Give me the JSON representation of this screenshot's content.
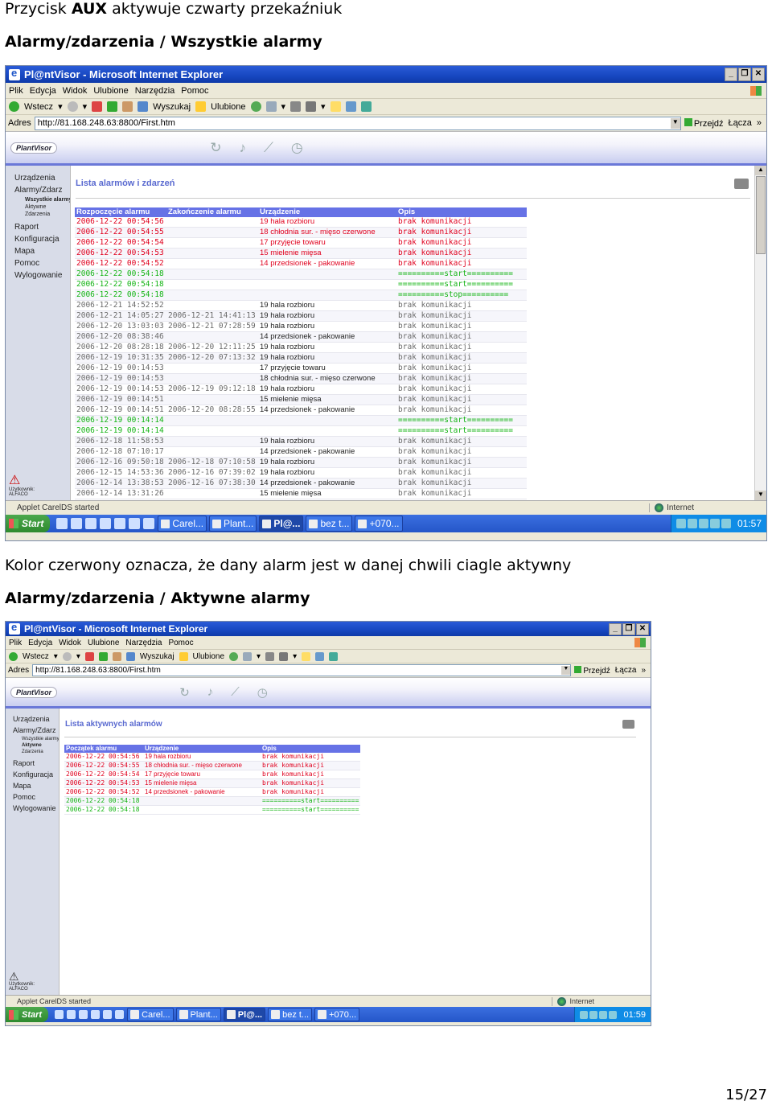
{
  "doc": {
    "intro_prefix": "Przycisk ",
    "intro_bold": "AUX",
    "intro_suffix": " aktywuje czwarty przekaźniuk",
    "heading1": "Alarmy/zdarzenia / Wszystkie alarmy",
    "note": "Kolor czerwony oznacza, że dany alarm jest w danej chwili ciagle aktywny",
    "heading2": "Alarmy/zdarzenia / Aktywne alarmy",
    "page_number": "15/27"
  },
  "browser": {
    "title": "Pl@ntVisor - Microsoft Internet Explorer",
    "menu": [
      "Plik",
      "Edycja",
      "Widok",
      "Ulubione",
      "Narzędzia",
      "Pomoc"
    ],
    "back": "Wstecz",
    "search": "Wyszukaj",
    "favorites": "Ulubione",
    "address_label": "Adres",
    "url": "http://81.168.248.63:8800/First.htm",
    "go": "Przejdź",
    "links": "Łącza",
    "status_text": "Applet CarelDS started",
    "zone": "Internet"
  },
  "plantvisor": {
    "logo": "PlantVisor",
    "user_label": "Użytkownik:",
    "user_name": "ALFACO"
  },
  "sidebar1": {
    "items_top": [
      "Urządzenia",
      "Alarmy/Zdarz"
    ],
    "subitems": [
      "Wszystkie alarmy",
      "Aktywne",
      "Zdarzenia"
    ],
    "items_bottom": [
      "Raport",
      "Konfiguracja",
      "Mapa",
      "Pomoc",
      "Wylogowanie"
    ]
  },
  "sidebar2": {
    "items_top": [
      "Urządzenia",
      "Alarmy/Zdarz"
    ],
    "subitems": [
      "Wszystkie alarmy",
      "Aktywne",
      "Zdarzenia"
    ],
    "items_bottom": [
      "Raport",
      "Konfiguracja",
      "Mapa",
      "Pomoc",
      "Wylogowanie"
    ]
  },
  "screen1": {
    "page_title": "Lista alarmów i zdarzeń",
    "columns": [
      "Rozpoczęcie alarmu",
      "Zakończenie alarmu",
      "Urządzenie",
      "Opis"
    ],
    "rows": [
      {
        "s": "red",
        "start": "2006-12-22 00:54:56",
        "end": "",
        "dev": "19 hala rozbioru",
        "desc": "brak komunikacji"
      },
      {
        "s": "red",
        "start": "2006-12-22 00:54:55",
        "end": "",
        "dev": "18 chłodnia sur. - mięso czerwone",
        "desc": "brak komunikacji"
      },
      {
        "s": "red",
        "start": "2006-12-22 00:54:54",
        "end": "",
        "dev": "17 przyjęcie towaru",
        "desc": "brak komunikacji"
      },
      {
        "s": "red",
        "start": "2006-12-22 00:54:53",
        "end": "",
        "dev": "15 mielenie mięsa",
        "desc": "brak komunikacji"
      },
      {
        "s": "red",
        "start": "2006-12-22 00:54:52",
        "end": "",
        "dev": "14 przedsionek - pakowanie",
        "desc": "brak komunikacji"
      },
      {
        "s": "green",
        "start": "2006-12-22 00:54:18",
        "end": "",
        "dev": "",
        "desc": "==========start=========="
      },
      {
        "s": "green",
        "start": "2006-12-22 00:54:18",
        "end": "",
        "dev": "",
        "desc": "==========start=========="
      },
      {
        "s": "green",
        "start": "2006-12-22 00:54:18",
        "end": "",
        "dev": "",
        "desc": "==========stop=========="
      },
      {
        "s": "gray",
        "start": "2006-12-21 14:52:52",
        "end": "",
        "dev": "19 hala rozbioru",
        "desc": "brak komunikacji"
      },
      {
        "s": "gray",
        "start": "2006-12-21 14:05:27",
        "end": "2006-12-21 14:41:13",
        "dev": "19 hala rozbioru",
        "desc": "brak komunikacji"
      },
      {
        "s": "gray",
        "start": "2006-12-20 13:03:03",
        "end": "2006-12-21 07:28:59",
        "dev": "19 hala rozbioru",
        "desc": "brak komunikacji"
      },
      {
        "s": "gray",
        "start": "2006-12-20 08:38:46",
        "end": "",
        "dev": "14 przedsionek - pakowanie",
        "desc": "brak komunikacji"
      },
      {
        "s": "gray",
        "start": "2006-12-20 08:28:18",
        "end": "2006-12-20 12:11:25",
        "dev": "19 hala rozbioru",
        "desc": "brak komunikacji"
      },
      {
        "s": "gray",
        "start": "2006-12-19 10:31:35",
        "end": "2006-12-20 07:13:32",
        "dev": "19 hala rozbioru",
        "desc": "brak komunikacji"
      },
      {
        "s": "gray",
        "start": "2006-12-19 00:14:53",
        "end": "",
        "dev": "17 przyjęcie towaru",
        "desc": "brak komunikacji"
      },
      {
        "s": "gray",
        "start": "2006-12-19 00:14:53",
        "end": "",
        "dev": "18 chłodnia sur. - mięso czerwone",
        "desc": "brak komunikacji"
      },
      {
        "s": "gray",
        "start": "2006-12-19 00:14:53",
        "end": "2006-12-19 09:12:18",
        "dev": "19 hala rozbioru",
        "desc": "brak komunikacji"
      },
      {
        "s": "gray",
        "start": "2006-12-19 00:14:51",
        "end": "",
        "dev": "15 mielenie mięsa",
        "desc": "brak komunikacji"
      },
      {
        "s": "gray",
        "start": "2006-12-19 00:14:51",
        "end": "2006-12-20 08:28:55",
        "dev": "14 przedsionek - pakowanie",
        "desc": "brak komunikacji"
      },
      {
        "s": "green",
        "start": "2006-12-19 00:14:14",
        "end": "",
        "dev": "",
        "desc": "==========start=========="
      },
      {
        "s": "green",
        "start": "2006-12-19 00:14:14",
        "end": "",
        "dev": "",
        "desc": "==========start=========="
      },
      {
        "s": "gray",
        "start": "2006-12-18 11:58:53",
        "end": "",
        "dev": "19 hala rozbioru",
        "desc": "brak komunikacji"
      },
      {
        "s": "gray",
        "start": "2006-12-18 07:10:17",
        "end": "",
        "dev": "14 przedsionek - pakowanie",
        "desc": "brak komunikacji"
      },
      {
        "s": "gray",
        "start": "2006-12-16 09:50:18",
        "end": "2006-12-18 07:10:58",
        "dev": "19 hala rozbioru",
        "desc": "brak komunikacji"
      },
      {
        "s": "gray",
        "start": "2006-12-15 14:53:36",
        "end": "2006-12-16 07:39:02",
        "dev": "19 hala rozbioru",
        "desc": "brak komunikacji"
      },
      {
        "s": "gray",
        "start": "2006-12-14 13:38:53",
        "end": "2006-12-16 07:38:30",
        "dev": "14 przedsionek - pakowanie",
        "desc": "brak komunikacji"
      },
      {
        "s": "gray",
        "start": "2006-12-14 13:31:26",
        "end": "",
        "dev": "15 mielenie mięsa",
        "desc": "brak komunikacji"
      }
    ]
  },
  "screen2": {
    "page_title": "Lista aktywnych alarmów",
    "columns": [
      "Początek alarmu",
      "Urządzenie",
      "Opis"
    ],
    "rows": [
      {
        "s": "red",
        "start": "2006-12-22 00:54:56",
        "dev": "19 hala rozbioru",
        "desc": "brak komunikacji"
      },
      {
        "s": "red",
        "start": "2006-12-22 00:54:55",
        "dev": "18 chłodnia sur. - mięso czerwone",
        "desc": "brak komunikacji"
      },
      {
        "s": "red",
        "start": "2006-12-22 00:54:54",
        "dev": "17 przyjęcie towaru",
        "desc": "brak komunikacji"
      },
      {
        "s": "red",
        "start": "2006-12-22 00:54:53",
        "dev": "15 mielenie mięsa",
        "desc": "brak komunikacji"
      },
      {
        "s": "red",
        "start": "2006-12-22 00:54:52",
        "dev": "14 przedsionek - pakowanie",
        "desc": "brak komunikacji"
      },
      {
        "s": "green",
        "start": "2006-12-22 00:54:18",
        "dev": "",
        "desc": "==========start=========="
      },
      {
        "s": "green",
        "start": "2006-12-22 00:54:18",
        "dev": "",
        "desc": "==========start=========="
      }
    ]
  },
  "taskbar1": {
    "start": "Start",
    "tasks": [
      "Carel...",
      "Plant...",
      "Pl@...",
      "bez t...",
      "+070..."
    ],
    "active_index": 2,
    "clock": "01:57"
  },
  "taskbar2": {
    "start": "Start",
    "tasks": [
      "Carel...",
      "Plant...",
      "Pl@...",
      "bez t...",
      "+070..."
    ],
    "active_index": 2,
    "clock": "01:59"
  },
  "colors": {
    "active_alarm": "#e0001e",
    "event": "#14b414",
    "past_alarm": "#6a6a6a",
    "table_header": "#6672e6"
  }
}
